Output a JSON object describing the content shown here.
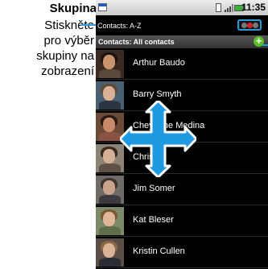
{
  "annotation": {
    "title": "Skupina",
    "description_lines": [
      "Stiskněte",
      "pro výběr",
      "skupiny na",
      "zobrazení"
    ]
  },
  "status_bar": {
    "time": "11:35"
  },
  "header": {
    "sort_label": "Contacts: A-Z"
  },
  "subheader": {
    "label": "Contacts: All contacts",
    "add_symbol": "+"
  },
  "contacts": [
    {
      "name": "Arthur Baudo"
    },
    {
      "name": "Barry Smyth"
    },
    {
      "name": "Cheyenne Medina"
    },
    {
      "name": "Chris"
    },
    {
      "name": "Jim Somer"
    },
    {
      "name": "Kat Bleser"
    },
    {
      "name": "Kristin Cullen"
    }
  ],
  "colors": {
    "callout": "#2a9bd8",
    "add_button": "#5cbf2a",
    "dpad": "#1f9ae0"
  },
  "icons": [
    "app-icon",
    "phone-icon",
    "signal-icon",
    "battery-icon",
    "group-toggle-icon",
    "add-icon",
    "dpad-icon"
  ]
}
